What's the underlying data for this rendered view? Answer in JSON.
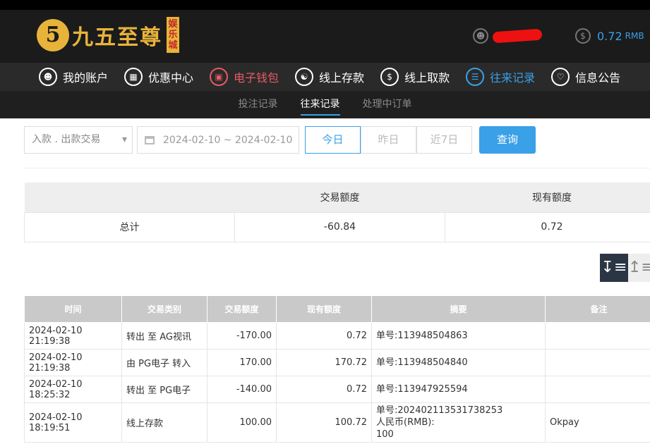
{
  "header": {
    "logo_badge": "5",
    "logo_text": "九五至尊",
    "logo_tag": "娱乐城",
    "balance_value": "0.72",
    "balance_unit": "RMB"
  },
  "nav": {
    "items": [
      {
        "label": "我的账户",
        "icon": "user-icon"
      },
      {
        "label": "优惠中心",
        "icon": "gift-icon"
      },
      {
        "label": "电子钱包",
        "icon": "wallet-icon"
      },
      {
        "label": "线上存款",
        "icon": "deposit-icon"
      },
      {
        "label": "线上取款",
        "icon": "withdraw-icon"
      },
      {
        "label": "往来记录",
        "icon": "records-icon"
      },
      {
        "label": "信息公告",
        "icon": "bell-icon"
      }
    ]
  },
  "subnav": {
    "tabs": [
      "投注记录",
      "往来记录",
      "处理中订单"
    ]
  },
  "filters": {
    "type_select": "入款 . 出款交易",
    "date_range": "2024-02-10 ~ 2024-02-10",
    "today": "今日",
    "yesterday": "昨日",
    "last7": "近7日",
    "query": "查询"
  },
  "summary": {
    "col_amount": "交易额度",
    "col_balance": "现有额度",
    "row_label": "总计",
    "amount": "-60.84",
    "balance": "0.72"
  },
  "records": {
    "headers": [
      "时间",
      "交易类别",
      "交易额度",
      "现有额度",
      "摘要",
      "备注"
    ],
    "rows": [
      {
        "time": "2024-02-10 21:19:38",
        "type": "转出 至 AG视讯",
        "amount": "-170.00",
        "balance": "0.72",
        "memo": "单号:113948504863",
        "note": ""
      },
      {
        "time": "2024-02-10 21:19:38",
        "type": "由 PG电子 转入",
        "amount": "170.00",
        "balance": "170.72",
        "memo": "单号:113948504840",
        "note": ""
      },
      {
        "time": "2024-02-10 18:25:32",
        "type": "转出 至 PG电子",
        "amount": "-140.00",
        "balance": "0.72",
        "memo": "单号:113947925594",
        "note": ""
      },
      {
        "time": "2024-02-10 18:19:51",
        "type": "线上存款",
        "amount": "100.00",
        "balance": "100.72",
        "memo": "单号:202402113531738253\n人民币(RMB):\n100",
        "note": "Okpay"
      }
    ]
  }
}
